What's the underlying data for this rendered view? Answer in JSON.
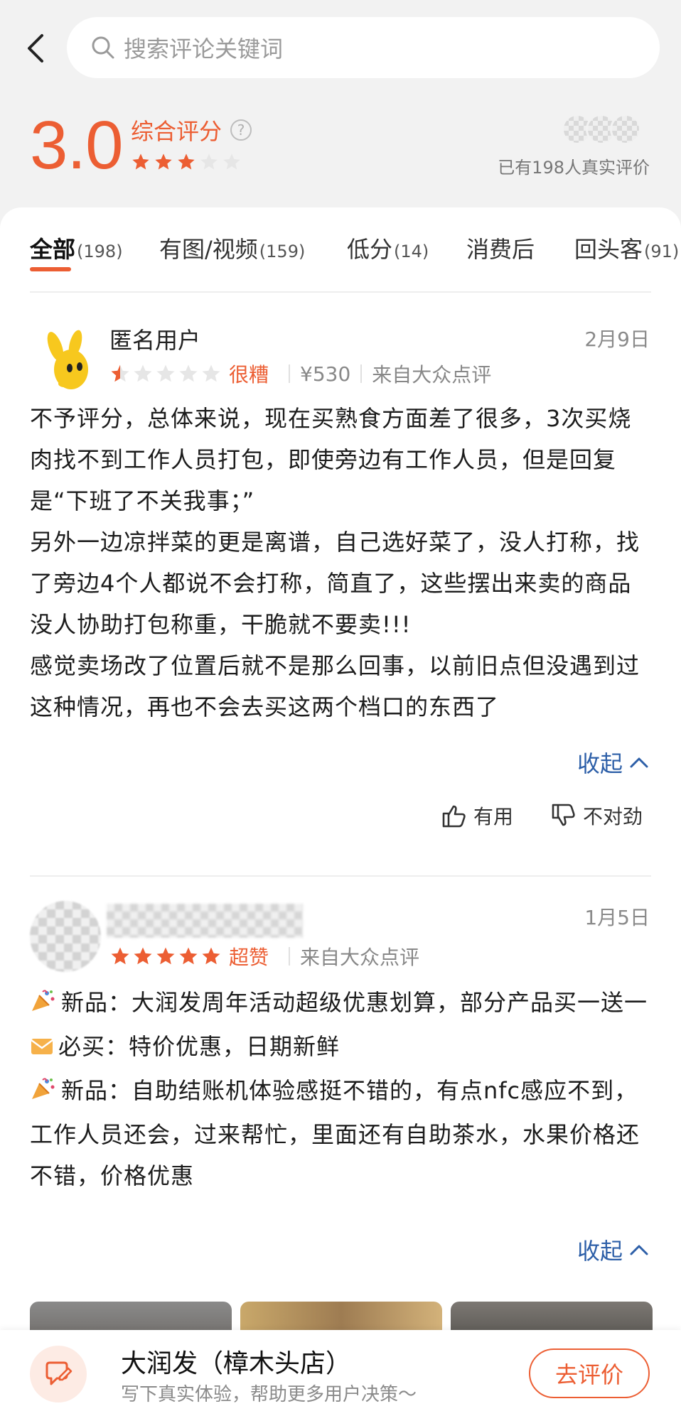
{
  "header": {
    "search_placeholder": "搜索评论关键词"
  },
  "summary": {
    "score": "3.0",
    "label": "综合评分",
    "help_glyph": "?",
    "rating_stars": 3,
    "real_count_text": "已有198人真实评价",
    "accent_color": "#ec5e33"
  },
  "tabs": [
    {
      "label": "全部",
      "count": "(198)",
      "active": true
    },
    {
      "label": "有图/视频",
      "count": "(159)",
      "active": false
    },
    {
      "label": "低分",
      "count": "(14)",
      "active": false
    },
    {
      "label": "消费后",
      "count": "",
      "active": false
    },
    {
      "label": "回头客",
      "count": "(91)",
      "active": false
    }
  ],
  "reviews": [
    {
      "user": "匿名用户",
      "date": "2月9日",
      "rating": 0.5,
      "rating_word": "很糟",
      "price": "¥530",
      "source": "来自大众点评",
      "paragraphs": [
        "不予评分，总体来说，现在买熟食方面差了很多，3次买烧肉找不到工作人员打包，即使旁边有工作人员，但是回复是“下班了不关我事；”",
        "另外一边凉拌菜的更是离谱，自己选好菜了，没人打称，找了旁边4个人都说不会打称，简直了，这些摆出来卖的商品没人协助打包称重，干脆就不要卖!!!",
        "感觉卖场改了位置后就不是那么回事，以前旧点但没遇到过这种情况，再也不会去买这两个档口的东西了"
      ],
      "collapse_label": "收起",
      "useful_label": "有用",
      "wrong_label": "不对劲"
    },
    {
      "user": "",
      "date": "1月5日",
      "rating": 5,
      "rating_word": "超赞",
      "source": "来自大众点评",
      "paragraphs": [
        {
          "icon": "party-popper-icon",
          "text": "新品：大润发周年活动超级优惠划算，部分产品买一送一"
        },
        {
          "icon": "envelope-icon",
          "text": "必买：特价优惠，日期新鲜"
        },
        {
          "icon": "party-popper-icon",
          "text": "新品：自助结账机体验感挺不错的，有点nfc感应不到，工作人员还会，过来帮忙，里面还有自助茶水，水果价格还不错，价格优惠"
        }
      ],
      "collapse_label": "收起"
    }
  ],
  "bottom_bar": {
    "store_name": "大润发（樟木头店）",
    "store_sub": "写下真实体验，帮助更多用户决策～",
    "write_button": "去评价"
  }
}
